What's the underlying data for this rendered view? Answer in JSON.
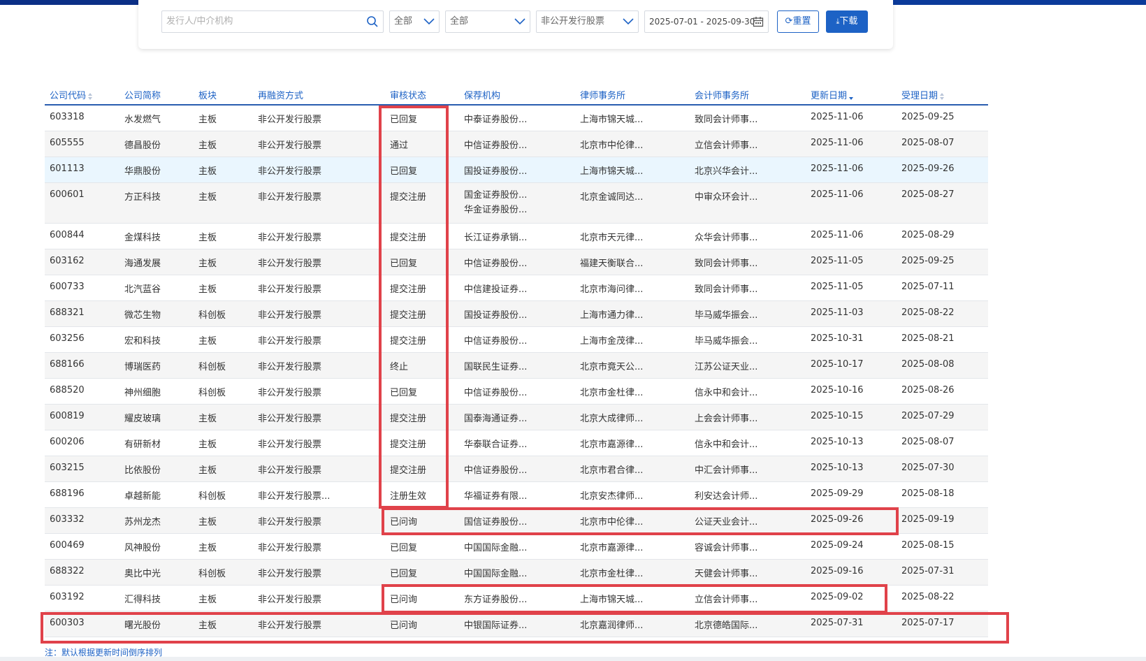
{
  "filters": {
    "search_placeholder": "发行人/中介机构",
    "market": "全部",
    "status": "全部",
    "financing_type": "非公开发行股票",
    "date_range": "2025-07-01 - 2025-09-30",
    "reset_label": "重置",
    "download_label": "下载"
  },
  "table": {
    "headers": [
      "公司代码",
      "公司简称",
      "板块",
      "再融资方式",
      "审核状态",
      "保荐机构",
      "律师事务所",
      "会计师事务所",
      "更新日期",
      "受理日期"
    ],
    "rows": [
      {
        "code": "603318",
        "name": "水发燃气",
        "board": "主板",
        "method": "非公开发行股票",
        "status": "已回复",
        "sponsor": [
          "中泰证券股份..."
        ],
        "law": "上海市锦天城...",
        "acct": "致同会计师事...",
        "updated": "2025-11-06",
        "accepted": "2025-09-25"
      },
      {
        "code": "605555",
        "name": "德昌股份",
        "board": "主板",
        "method": "非公开发行股票",
        "status": "通过",
        "sponsor": [
          "中信证券股份..."
        ],
        "law": "北京市中伦律...",
        "acct": "立信会计师事...",
        "updated": "2025-11-06",
        "accepted": "2025-08-07"
      },
      {
        "code": "601113",
        "name": "华鼎股份",
        "board": "主板",
        "method": "非公开发行股票",
        "status": "已回复",
        "sponsor": [
          "国投证券股份..."
        ],
        "law": "上海市锦天城...",
        "acct": "北京兴华会计...",
        "updated": "2025-11-06",
        "accepted": "2025-09-26"
      },
      {
        "code": "600601",
        "name": "方正科技",
        "board": "主板",
        "method": "非公开发行股票",
        "status": "提交注册",
        "sponsor": [
          "国金证券股份...",
          "华金证券股份..."
        ],
        "law": "北京金诚同达...",
        "acct": "中审众环会计...",
        "updated": "2025-11-06",
        "accepted": "2025-08-27"
      },
      {
        "code": "600844",
        "name": "金煤科技",
        "board": "主板",
        "method": "非公开发行股票",
        "status": "提交注册",
        "sponsor": [
          "长江证券承销..."
        ],
        "law": "北京市天元律...",
        "acct": "众华会计师事...",
        "updated": "2025-11-06",
        "accepted": "2025-08-29"
      },
      {
        "code": "603162",
        "name": "海通发展",
        "board": "主板",
        "method": "非公开发行股票",
        "status": "已回复",
        "sponsor": [
          "中信证券股份..."
        ],
        "law": "福建天衡联合...",
        "acct": "致同会计师事...",
        "updated": "2025-11-05",
        "accepted": "2025-09-25"
      },
      {
        "code": "600733",
        "name": "北汽蓝谷",
        "board": "主板",
        "method": "非公开发行股票",
        "status": "提交注册",
        "sponsor": [
          "中信建投证券..."
        ],
        "law": "北京市海问律...",
        "acct": "致同会计师事...",
        "updated": "2025-11-05",
        "accepted": "2025-07-11"
      },
      {
        "code": "688321",
        "name": "微芯生物",
        "board": "科创板",
        "method": "非公开发行股票",
        "status": "提交注册",
        "sponsor": [
          "国投证券股份..."
        ],
        "law": "上海市通力律...",
        "acct": "毕马威华振会...",
        "updated": "2025-11-03",
        "accepted": "2025-08-22"
      },
      {
        "code": "603256",
        "name": "宏和科技",
        "board": "主板",
        "method": "非公开发行股票",
        "status": "提交注册",
        "sponsor": [
          "中信证券股份..."
        ],
        "law": "上海市金茂律...",
        "acct": "毕马威华振会...",
        "updated": "2025-10-31",
        "accepted": "2025-08-21"
      },
      {
        "code": "688166",
        "name": "博瑞医药",
        "board": "科创板",
        "method": "非公开发行股票",
        "status": "终止",
        "sponsor": [
          "国联民生证券..."
        ],
        "law": "北京市竟天公...",
        "acct": "江苏公证天业...",
        "updated": "2025-10-17",
        "accepted": "2025-08-08"
      },
      {
        "code": "688520",
        "name": "神州细胞",
        "board": "科创板",
        "method": "非公开发行股票",
        "status": "已回复",
        "sponsor": [
          "中信证券股份..."
        ],
        "law": "北京市金杜律...",
        "acct": "信永中和会计...",
        "updated": "2025-10-16",
        "accepted": "2025-08-26"
      },
      {
        "code": "600819",
        "name": "耀皮玻璃",
        "board": "主板",
        "method": "非公开发行股票",
        "status": "提交注册",
        "sponsor": [
          "国泰海通证券..."
        ],
        "law": "北京大成律师...",
        "acct": "上会会计师事...",
        "updated": "2025-10-15",
        "accepted": "2025-07-29"
      },
      {
        "code": "600206",
        "name": "有研新材",
        "board": "主板",
        "method": "非公开发行股票",
        "status": "提交注册",
        "sponsor": [
          "华泰联合证券..."
        ],
        "law": "北京市嘉源律...",
        "acct": "信永中和会计...",
        "updated": "2025-10-13",
        "accepted": "2025-08-07"
      },
      {
        "code": "603215",
        "name": "比依股份",
        "board": "主板",
        "method": "非公开发行股票",
        "status": "提交注册",
        "sponsor": [
          "中信证券股份..."
        ],
        "law": "北京市君合律...",
        "acct": "中汇会计师事...",
        "updated": "2025-10-13",
        "accepted": "2025-07-30"
      },
      {
        "code": "688196",
        "name": "卓越新能",
        "board": "科创板",
        "method": "非公开发行股票...",
        "status": "注册生效",
        "sponsor": [
          "华福证券有限..."
        ],
        "law": "北京安杰律师...",
        "acct": "利安达会计师...",
        "updated": "2025-09-29",
        "accepted": "2025-08-18"
      },
      {
        "code": "603332",
        "name": "苏州龙杰",
        "board": "主板",
        "method": "非公开发行股票",
        "status": "已问询",
        "sponsor": [
          "国信证券股份..."
        ],
        "law": "北京市中伦律...",
        "acct": "公证天业会计...",
        "updated": "2025-09-26",
        "accepted": "2025-09-19"
      },
      {
        "code": "600469",
        "name": "风神股份",
        "board": "主板",
        "method": "非公开发行股票",
        "status": "已回复",
        "sponsor": [
          "中国国际金融..."
        ],
        "law": "北京市嘉源律...",
        "acct": "容诚会计师事...",
        "updated": "2025-09-24",
        "accepted": "2025-08-15"
      },
      {
        "code": "688322",
        "name": "奥比中光",
        "board": "科创板",
        "method": "非公开发行股票",
        "status": "已回复",
        "sponsor": [
          "中国国际金融..."
        ],
        "law": "北京市金杜律...",
        "acct": "天健会计师事...",
        "updated": "2025-09-16",
        "accepted": "2025-07-31"
      },
      {
        "code": "603192",
        "name": "汇得科技",
        "board": "主板",
        "method": "非公开发行股票",
        "status": "已问询",
        "sponsor": [
          "东方证券股份..."
        ],
        "law": "上海市锦天城...",
        "acct": "立信会计师事...",
        "updated": "2025-09-02",
        "accepted": "2025-08-22"
      },
      {
        "code": "600303",
        "name": "曙光股份",
        "board": "主板",
        "method": "非公开发行股票",
        "status": "已问询",
        "sponsor": [
          "中银国际证券..."
        ],
        "law": "北京嘉润律师...",
        "acct": "北京德皓国际...",
        "updated": "2025-07-31",
        "accepted": "2025-07-17"
      }
    ]
  },
  "footnote": "注：默认根据更新时间倒序排列",
  "colors": {
    "accent": "#1d62c5",
    "header_band": "#0b2f86",
    "annotation_red": "#e0424a"
  }
}
